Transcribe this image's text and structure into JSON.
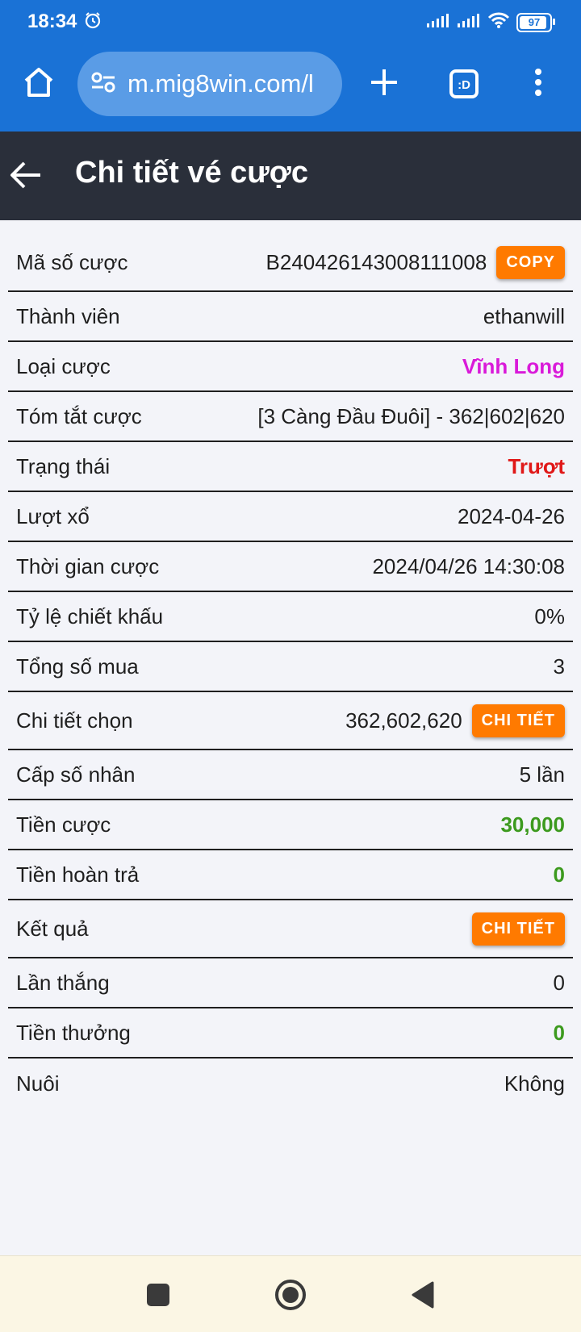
{
  "status_bar": {
    "time": "18:34",
    "battery": "97"
  },
  "browser": {
    "url": "m.mig8win.com/l",
    "tab_label": ":D"
  },
  "header": {
    "title": "Chi tiết vé cược"
  },
  "details": {
    "bet_id": {
      "label": "Mã số cược",
      "value": "B240426143008111008",
      "button": "COPY"
    },
    "member": {
      "label": "Thành viên",
      "value": "ethanwill"
    },
    "bet_type": {
      "label": "Loại cược",
      "value": "Vĩnh Long",
      "color": "#d91ad9"
    },
    "summary": {
      "label": "Tóm tắt cược",
      "value": "[3 Càng Đầu Đuôi] - 362|602|620"
    },
    "status": {
      "label": "Trạng thái",
      "value": "Trượt",
      "color": "#e01818"
    },
    "draw": {
      "label": "Lượt xổ",
      "value": "2024-04-26"
    },
    "bet_time": {
      "label": "Thời gian cược",
      "value": "2024/04/26 14:30:08"
    },
    "discount": {
      "label": "Tỷ lệ chiết khấu",
      "value": "0%"
    },
    "total_buy": {
      "label": "Tổng số mua",
      "value": "3"
    },
    "selection": {
      "label": "Chi tiết chọn",
      "value": "362,602,620",
      "button": "CHI TIẾT"
    },
    "multiplier": {
      "label": "Cấp số nhân",
      "value": "5 lần"
    },
    "stake": {
      "label": "Tiền cược",
      "value": "30,000",
      "color": "#3c9a1e"
    },
    "refund": {
      "label": "Tiền hoàn trả",
      "value": "0",
      "color": "#3c9a1e"
    },
    "result": {
      "label": "Kết quả",
      "button": "CHI TIẾT"
    },
    "wins": {
      "label": "Lần thắng",
      "value": "0"
    },
    "prize": {
      "label": "Tiền thưởng",
      "value": "0",
      "color": "#3c9a1e"
    },
    "nurture": {
      "label": "Nuôi",
      "value": "Không"
    }
  },
  "colors": {
    "accent_button": "#ff7a00",
    "header_bg": "#2a2f3a",
    "browser_bg": "#1a72d6"
  }
}
